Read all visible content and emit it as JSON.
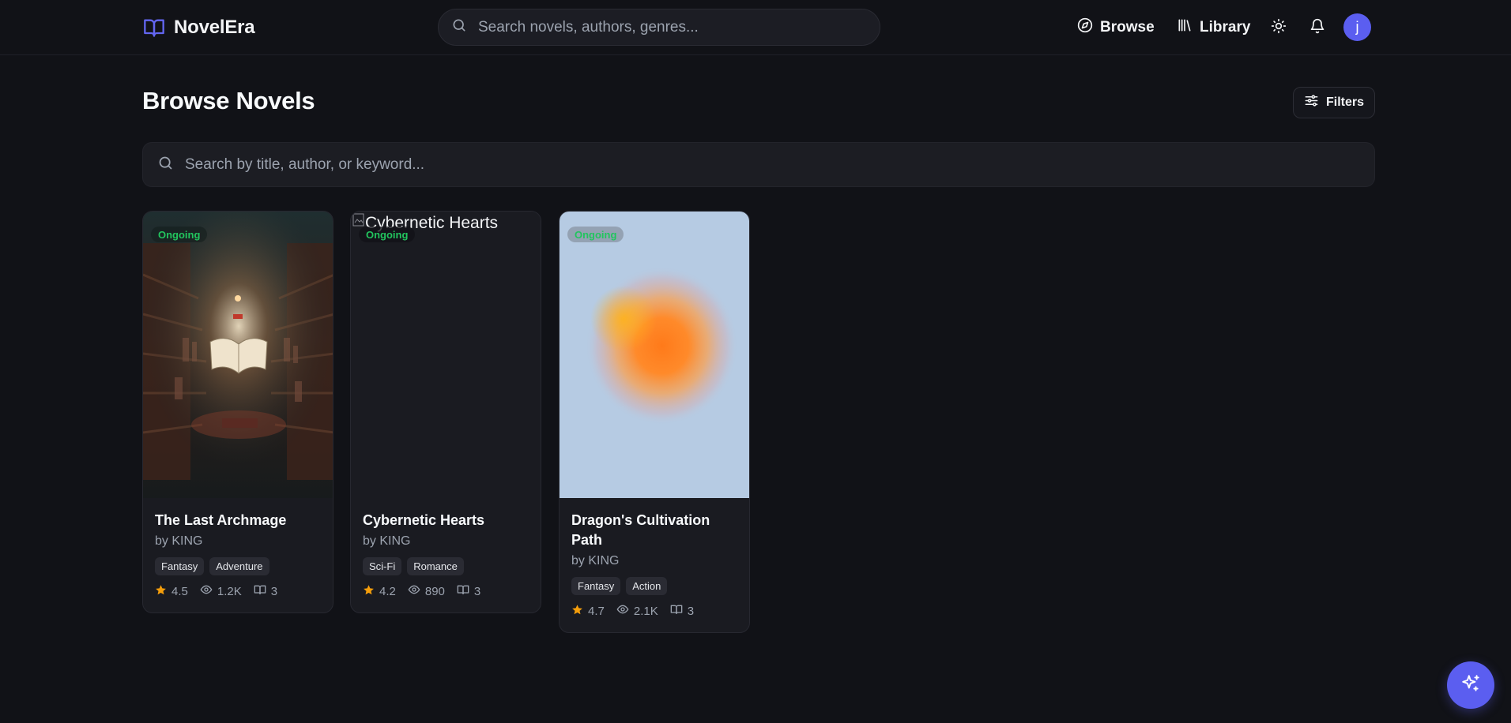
{
  "app": {
    "name": "NovelEra",
    "accent": "#5b5ef0",
    "brand_icon": "book-open-icon"
  },
  "topbar": {
    "search_placeholder": "Search novels, authors, genres...",
    "nav": [
      {
        "label": "Browse",
        "icon": "compass-icon"
      },
      {
        "label": "Library",
        "icon": "library-icon"
      }
    ],
    "theme_icon": "sun-icon",
    "notifications_icon": "bell-icon",
    "avatar_initial": "j"
  },
  "page": {
    "title": "Browse Novels",
    "filters_label": "Filters",
    "search_placeholder": "Search by title, author, or keyword..."
  },
  "novels": [
    {
      "title": "The Last Archmage",
      "author": "by KING",
      "status": "Ongoing",
      "tags": [
        "Fantasy",
        "Adventure"
      ],
      "rating": "4.5",
      "views": "1.2K",
      "chapters": "3",
      "cover_alt": ""
    },
    {
      "title": "Cybernetic Hearts",
      "author": "by KING",
      "status": "Ongoing",
      "tags": [
        "Sci-Fi",
        "Romance"
      ],
      "rating": "4.2",
      "views": "890",
      "chapters": "3",
      "cover_alt": "Cybernetic Hearts"
    },
    {
      "title": "Dragon's Cultivation Path",
      "author": "by KING",
      "status": "Ongoing",
      "tags": [
        "Fantasy",
        "Action"
      ],
      "rating": "4.7",
      "views": "2.1K",
      "chapters": "3",
      "cover_alt": ""
    }
  ],
  "fab_icon": "sparkles-icon",
  "colors": {
    "status": "#22c55e",
    "star": "#f59e0b",
    "background": "#111217"
  }
}
